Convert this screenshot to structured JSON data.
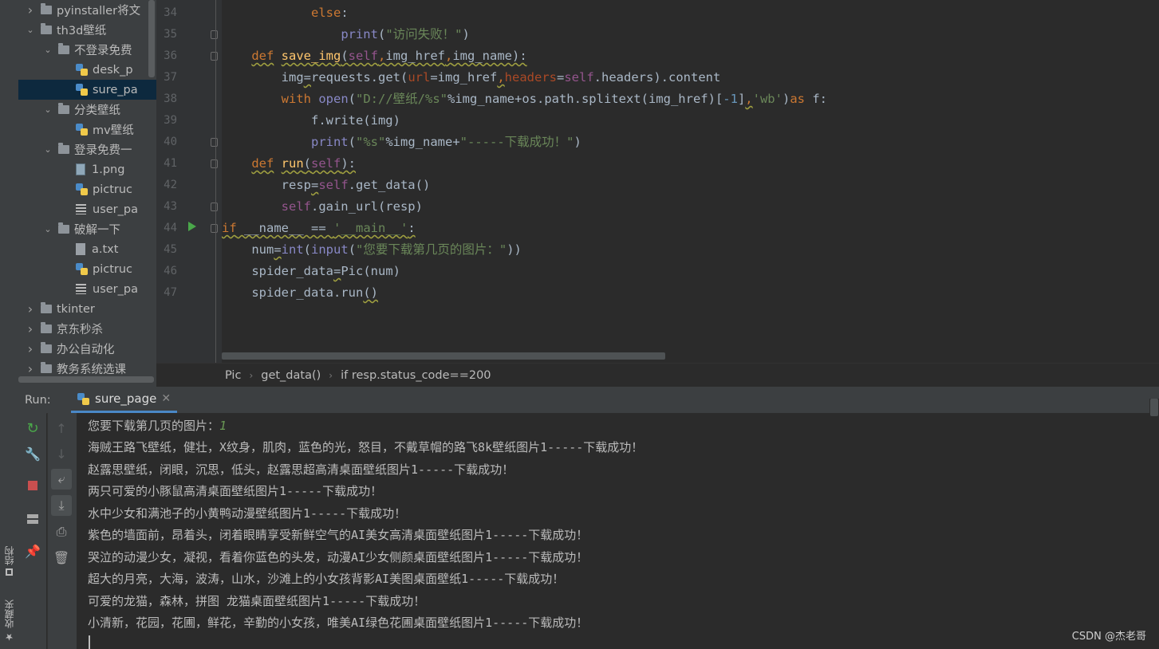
{
  "project_tree": [
    {
      "label": "pyinstaller将文",
      "type": "folder",
      "indent": 1,
      "expanded": false
    },
    {
      "label": "th3d壁纸",
      "type": "folder",
      "indent": 1,
      "expanded": true
    },
    {
      "label": "不登录免费",
      "type": "folder",
      "indent": 2,
      "expanded": true
    },
    {
      "label": "desk_p",
      "type": "py",
      "indent": 3
    },
    {
      "label": "sure_pa",
      "type": "py",
      "indent": 3,
      "selected": true
    },
    {
      "label": "分类壁纸",
      "type": "folder",
      "indent": 2,
      "expanded": true
    },
    {
      "label": "mv壁纸",
      "type": "py",
      "indent": 3
    },
    {
      "label": "登录免费一",
      "type": "folder",
      "indent": 2,
      "expanded": true
    },
    {
      "label": "1.png",
      "type": "image",
      "indent": 3
    },
    {
      "label": "pictruc",
      "type": "py",
      "indent": 3
    },
    {
      "label": "user_pa",
      "type": "list",
      "indent": 3
    },
    {
      "label": "破解一下",
      "type": "folder",
      "indent": 2,
      "expanded": true
    },
    {
      "label": "a.txt",
      "type": "txt",
      "indent": 3
    },
    {
      "label": "pictruc",
      "type": "py",
      "indent": 3
    },
    {
      "label": "user_pa",
      "type": "list",
      "indent": 3
    },
    {
      "label": "tkinter",
      "type": "folder",
      "indent": 1,
      "expanded": false
    },
    {
      "label": "京东秒杀",
      "type": "folder",
      "indent": 1,
      "expanded": false
    },
    {
      "label": "办公自动化",
      "type": "folder",
      "indent": 1,
      "expanded": false
    },
    {
      "label": "教务系统选课",
      "type": "folder",
      "indent": 1,
      "expanded": false
    }
  ],
  "left_strip": {
    "structure_tab": "结构",
    "favorites_tab": "收藏夹"
  },
  "editor": {
    "line_numbers": [
      "34",
      "35",
      "36",
      "37",
      "38",
      "39",
      "40",
      "41",
      "42",
      "43",
      "44",
      "45",
      "46",
      "47"
    ],
    "code_lines": [
      [
        {
          "t": "            "
        },
        {
          "t": "else",
          "c": "kw"
        },
        {
          "t": ":"
        }
      ],
      [
        {
          "t": "                "
        },
        {
          "t": "print",
          "c": "bi"
        },
        {
          "t": "("
        },
        {
          "t": "\"访问失败！\"",
          "c": "str"
        },
        {
          "t": ")"
        }
      ],
      [
        {
          "t": "    "
        },
        {
          "t": "def",
          "c": "kw sq"
        },
        {
          "t": " "
        },
        {
          "t": "save_img",
          "c": "fn sq"
        },
        {
          "t": "(",
          "c": "sq"
        },
        {
          "t": "self",
          "c": "slf sq"
        },
        {
          "t": ",",
          "c": "kw sq"
        },
        {
          "t": "img_href",
          "c": "sq"
        },
        {
          "t": ",",
          "c": "kw sq"
        },
        {
          "t": "img_name):",
          "c": "sq"
        }
      ],
      [
        {
          "t": "        "
        },
        {
          "t": "img"
        },
        {
          "t": "=",
          "c": "sq"
        },
        {
          "t": "requests.get("
        },
        {
          "t": "url",
          "c": "prm"
        },
        {
          "t": "=img_href"
        },
        {
          "t": ",",
          "c": "kw sq"
        },
        {
          "t": "headers",
          "c": "prm"
        },
        {
          "t": "="
        },
        {
          "t": "self",
          "c": "slf"
        },
        {
          "t": ".headers).content"
        }
      ],
      [
        {
          "t": "        "
        },
        {
          "t": "with",
          "c": "kw"
        },
        {
          "t": " "
        },
        {
          "t": "open",
          "c": "bi"
        },
        {
          "t": "("
        },
        {
          "t": "\"D://壁纸/%s\"",
          "c": "str"
        },
        {
          "t": "%img_name+os.path.splitext(img_href)["
        },
        {
          "t": "-1",
          "c": "num"
        },
        {
          "t": "]"
        },
        {
          "t": ",",
          "c": "kw sq"
        },
        {
          "t": "'wb'",
          "c": "str"
        },
        {
          "t": ")"
        },
        {
          "t": "as",
          "c": "kw"
        },
        {
          "t": " f:"
        }
      ],
      [
        {
          "t": "            "
        },
        {
          "t": "f.write(img)"
        }
      ],
      [
        {
          "t": "            "
        },
        {
          "t": "print",
          "c": "bi"
        },
        {
          "t": "("
        },
        {
          "t": "\"%s\"",
          "c": "str"
        },
        {
          "t": "%img_name+"
        },
        {
          "t": "\"-----下载成功！\"",
          "c": "str"
        },
        {
          "t": ")"
        }
      ],
      [
        {
          "t": "    "
        },
        {
          "t": "def",
          "c": "kw sq"
        },
        {
          "t": " "
        },
        {
          "t": "run",
          "c": "fn sq"
        },
        {
          "t": "(",
          "c": "sq"
        },
        {
          "t": "self",
          "c": "slf sq"
        },
        {
          "t": "):",
          "c": "sq"
        }
      ],
      [
        {
          "t": "        "
        },
        {
          "t": "resp"
        },
        {
          "t": "=",
          "c": "sq"
        },
        {
          "t": "self",
          "c": "slf"
        },
        {
          "t": ".get_data()"
        }
      ],
      [
        {
          "t": "        "
        },
        {
          "t": "self",
          "c": "slf"
        },
        {
          "t": ".gain_url(resp)"
        }
      ],
      [
        {
          "t": "if",
          "c": "kw sq"
        },
        {
          "t": " __name__ == ",
          "c": "sq"
        },
        {
          "t": "'__main__'",
          "c": "str sq"
        },
        {
          "t": ":",
          "c": "sq"
        }
      ],
      [
        {
          "t": "    "
        },
        {
          "t": "num"
        },
        {
          "t": "=",
          "c": "sq"
        },
        {
          "t": "int",
          "c": "bi"
        },
        {
          "t": "("
        },
        {
          "t": "input",
          "c": "bi"
        },
        {
          "t": "("
        },
        {
          "t": "\"您要下载第几页的图片：\"",
          "c": "str"
        },
        {
          "t": "))"
        }
      ],
      [
        {
          "t": "    "
        },
        {
          "t": "spider_data"
        },
        {
          "t": "=",
          "c": "sq"
        },
        {
          "t": "Pic(num)"
        }
      ],
      [
        {
          "t": "    "
        },
        {
          "t": "spider_data.run"
        },
        {
          "t": "()",
          "c": "sq"
        }
      ]
    ]
  },
  "breadcrumb": [
    "Pic",
    "get_data()",
    "if resp.status_code==200"
  ],
  "run_panel": {
    "label": "Run:",
    "tab_name": "sure_page",
    "prompt": "您要下载第几页的图片：",
    "prompt_input": "1",
    "output_lines": [
      "海贼王路飞壁纸，健壮，X纹身，肌肉，蓝色的光，怒目，不戴草帽的路飞8k壁纸图片1-----下载成功！",
      "赵露思壁纸，闭眼，沉思，低头，赵露思超高清桌面壁纸图片1-----下载成功！",
      "两只可爱的小豚鼠高清桌面壁纸图片1-----下载成功！",
      "水中少女和满池子的小黄鸭动漫壁纸图片1-----下载成功！",
      "紫色的墙面前，昂着头，闭着眼睛享受新鲜空气的AI美女高清桌面壁纸图片1-----下载成功！",
      "哭泣的动漫少女，凝视，看着你蓝色的头发，动漫AI少女侧颜桌面壁纸图片1-----下载成功！",
      "超大的月亮，大海，波涛，山水，沙滩上的小女孩背影AI美图桌面壁纸1-----下载成功！",
      "可爱的龙猫，森林，拼图 龙猫桌面壁纸图片1-----下载成功！",
      "小清新，花园，花圃，鲜花，辛勤的小女孩，唯美AI绿色花圃桌面壁纸图片1-----下载成功！"
    ]
  },
  "watermark": "CSDN @杰老哥"
}
